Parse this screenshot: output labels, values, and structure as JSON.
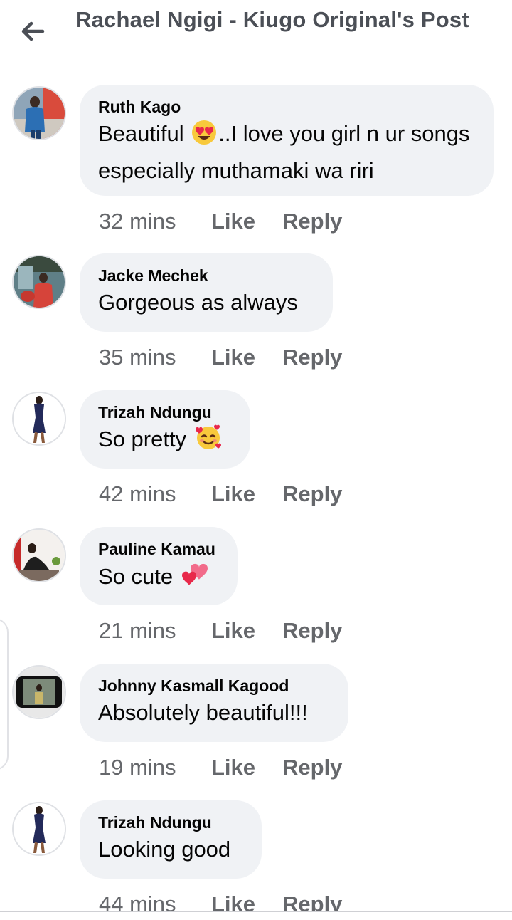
{
  "header": {
    "title": "Rachael Ngigi - Kiugo Original's Post",
    "back_icon": "arrow-left-icon"
  },
  "colors": {
    "bubble": "#f0f2f5",
    "meta_text": "#65676b",
    "title_text": "#4b4f56"
  },
  "comments": [
    {
      "author": "Ruth Kago",
      "text_before": "Beautiful ",
      "emoji": "heart-eyes-emoji",
      "text_after": "..I love you girl n ur songs especially muthamaki wa riri",
      "time": "32 mins",
      "like": "Like",
      "reply": "Reply"
    },
    {
      "author": "Jacke Mechek",
      "text_before": "Gorgeous as always",
      "time": "35 mins",
      "like": "Like",
      "reply": "Reply"
    },
    {
      "author": "Trizah Ndungu",
      "text_before": "So pretty ",
      "emoji": "smiling-face-with-hearts-emoji",
      "time": "42 mins",
      "like": "Like",
      "reply": "Reply"
    },
    {
      "author": "Pauline Kamau",
      "text_before": "So cute ",
      "emoji": "two-hearts-emoji",
      "time": "21 mins",
      "like": "Like",
      "reply": "Reply"
    },
    {
      "author": "Johnny Kasmall Kagood",
      "text_before": "Absolutely beautiful!!!",
      "time": "19 mins",
      "like": "Like",
      "reply": "Reply"
    },
    {
      "author": "Trizah Ndungu",
      "text_before": "Looking good",
      "time": "44 mins",
      "like": "Like",
      "reply": "Reply"
    }
  ]
}
